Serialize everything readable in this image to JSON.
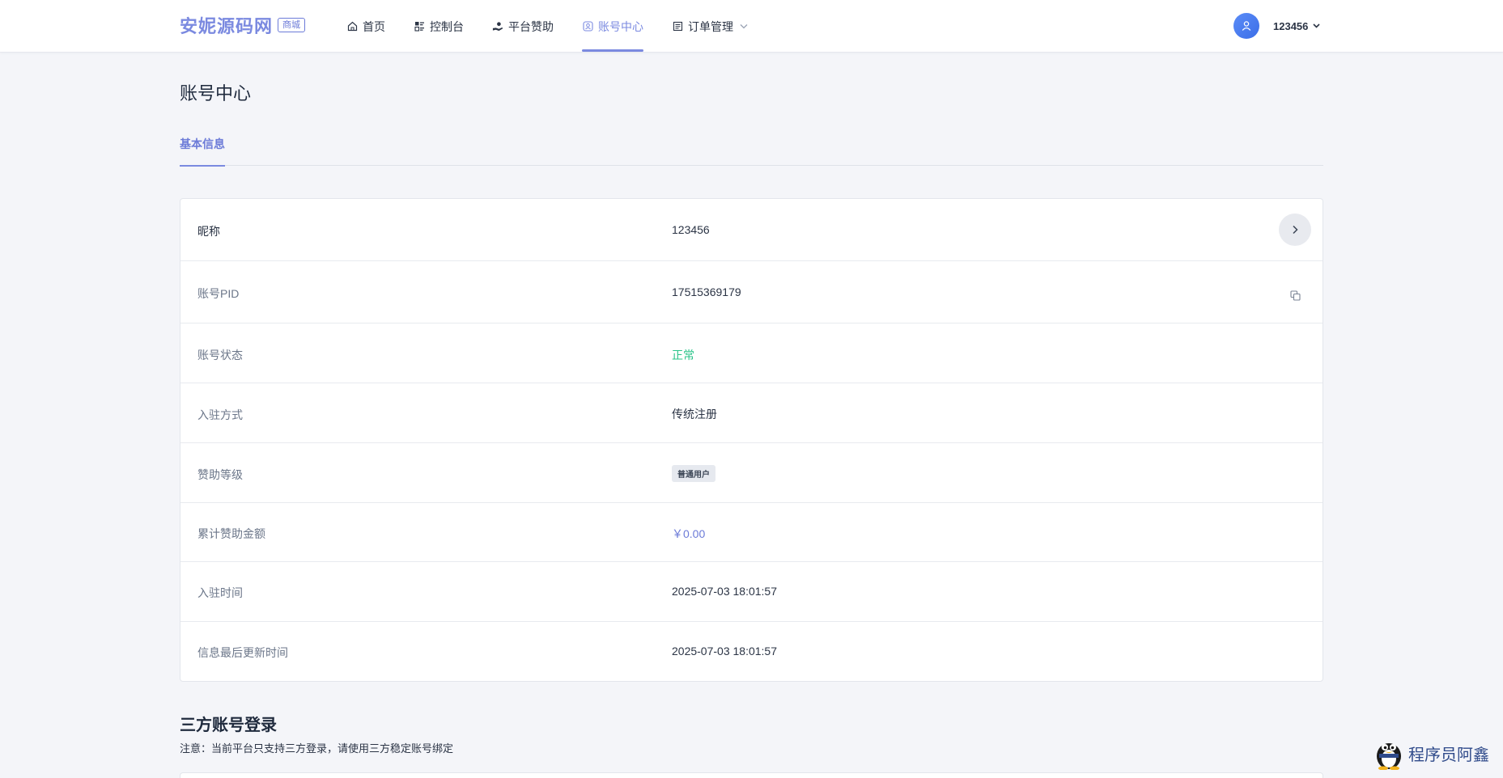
{
  "brand": {
    "name": "安妮源码网",
    "badge": "商城"
  },
  "nav": {
    "items": [
      {
        "label": "首页",
        "icon": "home-icon"
      },
      {
        "label": "控制台",
        "icon": "dashboard-icon"
      },
      {
        "label": "平台赞助",
        "icon": "donate-icon"
      },
      {
        "label": "账号中心",
        "icon": "account-icon",
        "active": true
      },
      {
        "label": "订单管理",
        "icon": "order-icon",
        "dropdown": true
      }
    ]
  },
  "user": {
    "name": "123456"
  },
  "page": {
    "title": "账号中心"
  },
  "tabs": [
    {
      "label": "基本信息",
      "active": true
    }
  ],
  "info": {
    "rows": [
      {
        "label": "昵称",
        "value": "123456"
      },
      {
        "label": "账号PID",
        "value": "17515369179"
      },
      {
        "label": "账号状态",
        "value": "正常"
      },
      {
        "label": "入驻方式",
        "value": "传统注册"
      },
      {
        "label": "赞助等级",
        "value": "普通用户"
      },
      {
        "label": "累计赞助金额",
        "value": "￥0.00"
      },
      {
        "label": "入驻时间",
        "value": "2025-07-03 18:01:57"
      },
      {
        "label": "信息最后更新时间",
        "value": "2025-07-03 18:01:57"
      }
    ]
  },
  "third_party": {
    "title": "三方账号登录",
    "note": "注意：当前平台只支持三方登录，请使用三方稳定账号绑定"
  },
  "watermark": {
    "text": "程序员阿鑫"
  },
  "colors": {
    "accent": "#7b8ae0",
    "success": "#2bc48a",
    "background": "#f4f5f9"
  }
}
